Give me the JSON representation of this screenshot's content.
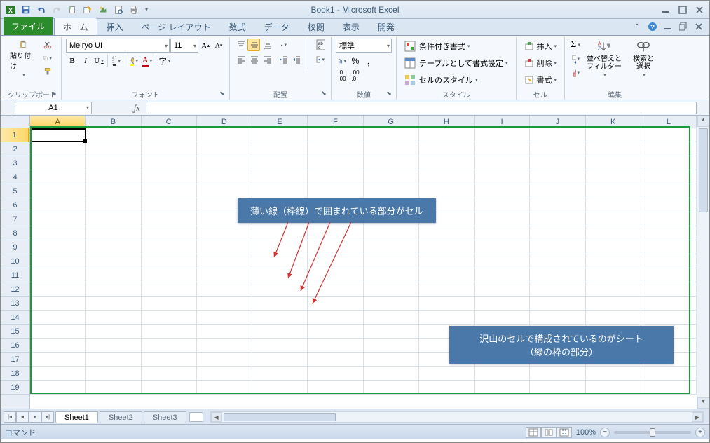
{
  "title": "Book1 - Microsoft Excel",
  "qat": {
    "save": "save-icon",
    "undo": "undo-icon",
    "redo": "redo-icon"
  },
  "tabs": {
    "file": "ファイル",
    "list": [
      "ホーム",
      "挿入",
      "ページ レイアウト",
      "数式",
      "データ",
      "校閲",
      "表示",
      "開発"
    ],
    "active": 0
  },
  "ribbon": {
    "clipboard": {
      "paste": "貼り付け",
      "label": "クリップボード"
    },
    "font": {
      "name": "Meiryo UI",
      "size": "11",
      "label": "フォント"
    },
    "align": {
      "label": "配置"
    },
    "number": {
      "format": "標準",
      "label": "数値"
    },
    "styles": {
      "cond": "条件付き書式",
      "table": "テーブルとして書式設定",
      "cell": "セルのスタイル",
      "label": "スタイル"
    },
    "cells": {
      "insert": "挿入",
      "delete": "削除",
      "format": "書式",
      "label": "セル"
    },
    "editing": {
      "sort": "並べ替えと\nフィルター",
      "find": "検索と\n選択",
      "label": "編集"
    }
  },
  "namebox": "A1",
  "fx": "fx",
  "cols": [
    "A",
    "B",
    "C",
    "D",
    "E",
    "F",
    "G",
    "H",
    "I",
    "J",
    "K",
    "L"
  ],
  "rows": [
    "1",
    "2",
    "3",
    "4",
    "5",
    "6",
    "7",
    "8",
    "9",
    "10",
    "11",
    "12",
    "13",
    "14",
    "15",
    "16",
    "17",
    "18",
    "19"
  ],
  "sheets": {
    "active": "Sheet1",
    "others": [
      "Sheet2",
      "Sheet3"
    ]
  },
  "status": {
    "mode": "コマンド",
    "zoom": "100%"
  },
  "callout1": "薄い線（枠線）で囲まれている部分がセル",
  "callout2_l1": "沢山のセルで構成されているのがシート",
  "callout2_l2": "（緑の枠の部分）"
}
